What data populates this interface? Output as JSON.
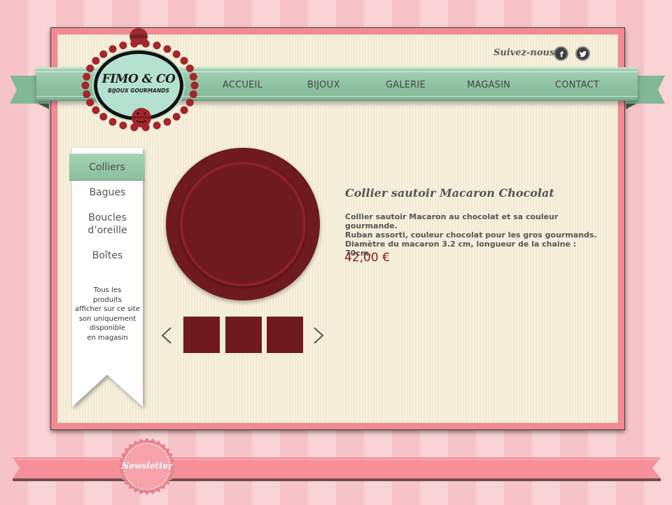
{
  "header": {
    "social_label": "Suivez-nous",
    "social_icons": [
      "facebook-icon",
      "twitter-icon"
    ]
  },
  "logo": {
    "name": "FIMO & CO",
    "tagline": "BIJOUX GOURMANDS"
  },
  "nav": {
    "items": [
      "ACCUEIL",
      "BIJOUX",
      "GALERIE",
      "MAGASIN",
      "CONTACT"
    ]
  },
  "side_menu": {
    "active": "Colliers",
    "items": [
      "Bagues",
      "Boucles\nd’oreille",
      "Boîtes"
    ],
    "note": "Tous les\nproduits\nafficher sur ce site\nson uniquement\ndisponible\nen magasin"
  },
  "product": {
    "title": "Collier sautoir Macaron Chocolat",
    "description": "Collier sautoir Macaron au chocolat et sa couleur gourmande.\nRuban assorti, couleur chocolat pour les gros gourmands.\nDiamètre du macaron 3.2 cm, longueur de la chaine : 70cm.",
    "price": "42,00 €",
    "thumbnail_count": 3
  },
  "footer": {
    "newsletter_label": "Newsletter"
  },
  "colors": {
    "mint": "#92c4a6",
    "pink": "#f18a93",
    "cream": "#f4eddb",
    "macaron": "#6e1a1f",
    "price": "#8d1b25"
  }
}
